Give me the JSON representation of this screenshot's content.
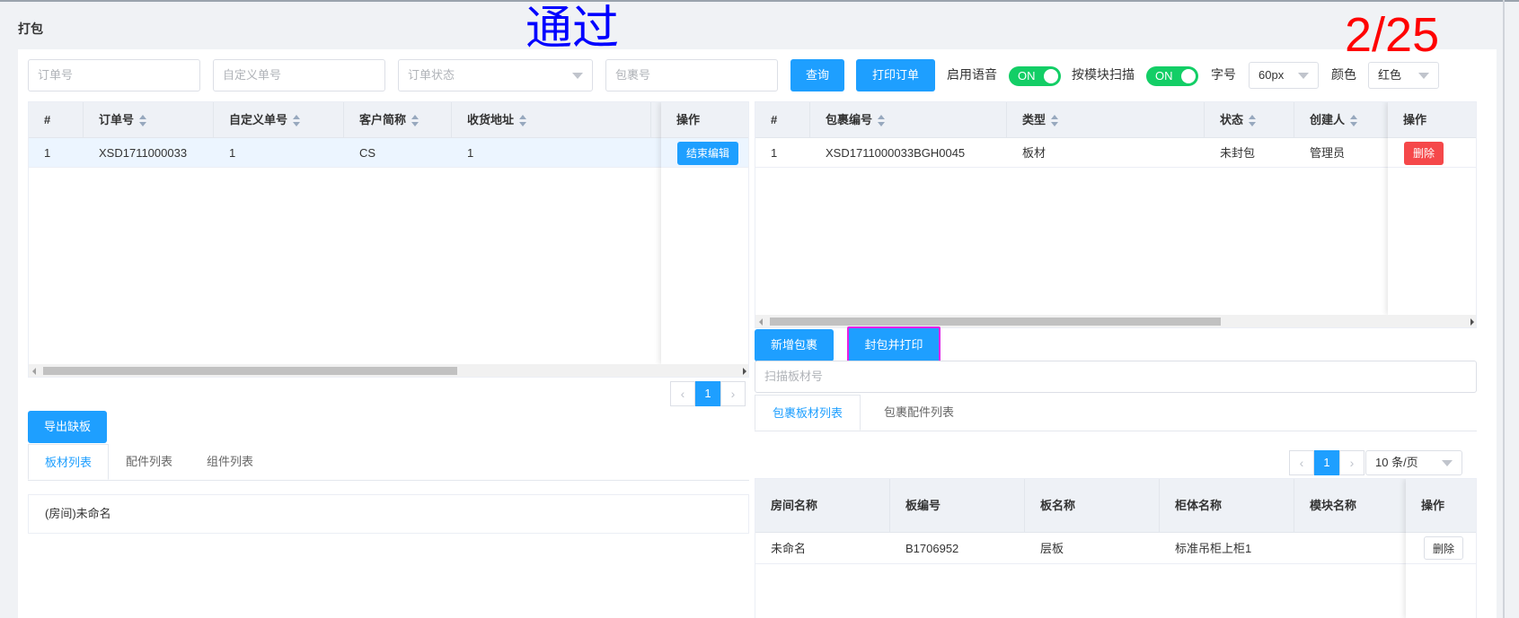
{
  "page": {
    "title": "打包",
    "overlay_status": "通过",
    "overlay_count": "2/25"
  },
  "toolbar": {
    "order_no_placeholder": "订单号",
    "custom_no_placeholder": "自定义单号",
    "order_status_placeholder": "订单状态",
    "package_no_placeholder": "包裹号",
    "query_label": "查询",
    "print_order_label": "打印订单",
    "voice_label": "启用语音",
    "voice_switch": "ON",
    "module_scan_label": "按模块扫描",
    "module_scan_switch": "ON",
    "font_size_label": "字号",
    "font_size_value": "60px",
    "color_label": "颜色",
    "color_value": "红色"
  },
  "orders_table": {
    "headers": [
      "#",
      "订单号",
      "自定义单号",
      "客户简称",
      "收货地址",
      "操作"
    ],
    "rows": [
      {
        "idx": "1",
        "order_no": "XSD1711000033",
        "custom_no": "1",
        "customer": "CS",
        "address": "1",
        "action": "结束编辑"
      }
    ],
    "page": "1"
  },
  "packages_table": {
    "headers": [
      "#",
      "包裹编号",
      "类型",
      "状态",
      "创建人",
      "操作"
    ],
    "rows": [
      {
        "idx": "1",
        "package_no": "XSD1711000033BGH0045",
        "type": "板材",
        "status": "未封包",
        "creator": "管理员",
        "action": "删除"
      }
    ]
  },
  "package_actions": {
    "new_label": "新增包裹",
    "seal_print_label": "封包并打印",
    "scan_placeholder": "扫描板材号"
  },
  "left_bottom": {
    "export_label": "导出缺板",
    "tabs": [
      "板材列表",
      "配件列表",
      "组件列表"
    ],
    "group_label": "(房间)未命名"
  },
  "right_bottom": {
    "tabs": [
      "包裹板材列表",
      "包裹配件列表"
    ],
    "page": "1",
    "page_size": "10 条/页",
    "headers": [
      "房间名称",
      "板编号",
      "板名称",
      "柜体名称",
      "模块名称",
      "操作"
    ],
    "rows": [
      {
        "room": "未命名",
        "board_no": "B1706952",
        "board_name": "层板",
        "cabinet": "标准吊柜上柜1",
        "module": "",
        "action": "删除"
      }
    ]
  },
  "colors": {
    "primary": "#1e9fff",
    "danger": "#f5484a",
    "switch_on": "#13ce66",
    "highlight_border": "#e51fe5"
  }
}
